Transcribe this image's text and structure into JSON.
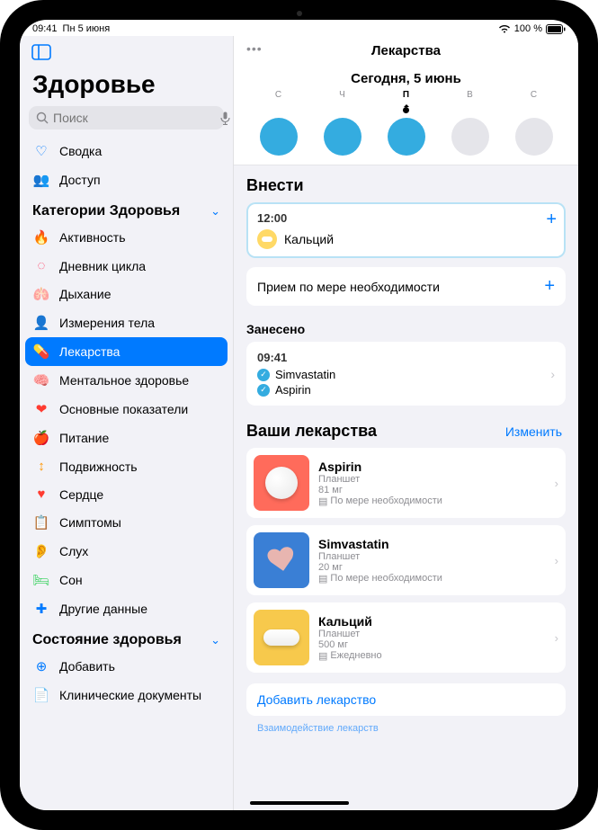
{
  "status": {
    "time": "09:41",
    "date": "Пн 5 июня",
    "battery_pct": "100 %"
  },
  "app_title": "Здоровье",
  "search_placeholder": "Поиск",
  "nav_simple": [
    {
      "label": "Сводка",
      "icon": "♡",
      "color": "#007aff"
    },
    {
      "label": "Доступ",
      "icon": "👥",
      "color": "#007aff"
    }
  ],
  "section_categories": "Категории Здоровья",
  "categories": [
    {
      "label": "Активность",
      "icon": "🔥",
      "color": "#ff3b30"
    },
    {
      "label": "Дневник цикла",
      "icon": "◌",
      "color": "#ff2d55"
    },
    {
      "label": "Дыхание",
      "icon": "🫁",
      "color": "#5ac8fa"
    },
    {
      "label": "Измерения тела",
      "icon": "👤",
      "color": "#af52de"
    },
    {
      "label": "Лекарства",
      "icon": "💊",
      "color": "#5ac8fa",
      "selected": true
    },
    {
      "label": "Ментальное здоровье",
      "icon": "🧠",
      "color": "#34c759"
    },
    {
      "label": "Основные показатели",
      "icon": "❤",
      "color": "#ff3b30"
    },
    {
      "label": "Питание",
      "icon": "🍎",
      "color": "#34c759"
    },
    {
      "label": "Подвижность",
      "icon": "↕",
      "color": "#ff9500"
    },
    {
      "label": "Сердце",
      "icon": "♥",
      "color": "#ff3b30"
    },
    {
      "label": "Симптомы",
      "icon": "📋",
      "color": "#5e5ce6"
    },
    {
      "label": "Слух",
      "icon": "👂",
      "color": "#007aff"
    },
    {
      "label": "Сон",
      "icon": "🛏",
      "color": "#30d158"
    },
    {
      "label": "Другие данные",
      "icon": "✚",
      "color": "#007aff"
    }
  ],
  "section_health_status": "Состояние здоровья",
  "health_status": [
    {
      "label": "Добавить",
      "icon": "⊕",
      "color": "#007aff"
    },
    {
      "label": "Клинические документы",
      "icon": "📄",
      "color": "#8e8e93"
    }
  ],
  "main": {
    "title": "Лекарства",
    "date": "Сегодня, 5 июнь",
    "week": [
      {
        "letter": "С",
        "state": "filled"
      },
      {
        "letter": "Ч",
        "state": "filled"
      },
      {
        "letter": "П",
        "state": "filled",
        "today": true
      },
      {
        "letter": "В",
        "state": "empty"
      },
      {
        "letter": "С",
        "state": "empty"
      }
    ],
    "log_header": "Внести",
    "scheduled": {
      "time": "12:00",
      "med": "Кальций"
    },
    "prn_label": "Прием по мере необходимости",
    "logged_header": "Занесено",
    "logged": {
      "time": "09:41",
      "items": [
        "Simvastatin",
        "Aspirin"
      ]
    },
    "your_meds_header": "Ваши лекарства",
    "edit": "Изменить",
    "meds": [
      {
        "name": "Aspirin",
        "form": "Планшет",
        "dose": "81 мг",
        "sched": "По мере необходимости",
        "color": "red",
        "shape": "round"
      },
      {
        "name": "Simvastatin",
        "form": "Планшет",
        "dose": "20 мг",
        "sched": "По мере необходимости",
        "color": "blue",
        "shape": "heart"
      },
      {
        "name": "Кальций",
        "form": "Планшет",
        "dose": "500 мг",
        "sched": "Ежедневно",
        "color": "yellow",
        "shape": "capsule"
      }
    ],
    "add_med": "Добавить лекарство",
    "cut_off": "Взаимодействие лекарств"
  }
}
